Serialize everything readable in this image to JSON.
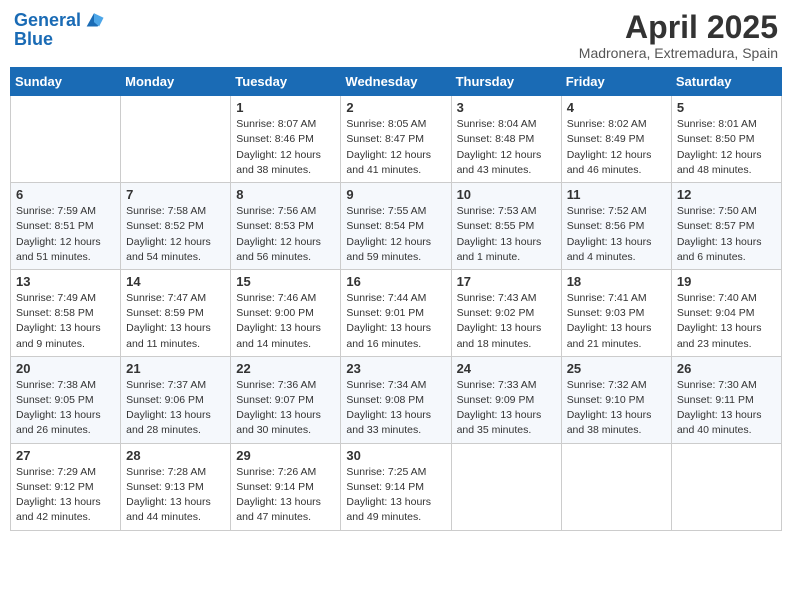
{
  "header": {
    "logo_line1": "General",
    "logo_line2": "Blue",
    "month_title": "April 2025",
    "location": "Madronera, Extremadura, Spain"
  },
  "weekdays": [
    "Sunday",
    "Monday",
    "Tuesday",
    "Wednesday",
    "Thursday",
    "Friday",
    "Saturday"
  ],
  "weeks": [
    [
      {
        "day": "",
        "sunrise": "",
        "sunset": "",
        "daylight": ""
      },
      {
        "day": "",
        "sunrise": "",
        "sunset": "",
        "daylight": ""
      },
      {
        "day": "1",
        "sunrise": "Sunrise: 8:07 AM",
        "sunset": "Sunset: 8:46 PM",
        "daylight": "Daylight: 12 hours and 38 minutes."
      },
      {
        "day": "2",
        "sunrise": "Sunrise: 8:05 AM",
        "sunset": "Sunset: 8:47 PM",
        "daylight": "Daylight: 12 hours and 41 minutes."
      },
      {
        "day": "3",
        "sunrise": "Sunrise: 8:04 AM",
        "sunset": "Sunset: 8:48 PM",
        "daylight": "Daylight: 12 hours and 43 minutes."
      },
      {
        "day": "4",
        "sunrise": "Sunrise: 8:02 AM",
        "sunset": "Sunset: 8:49 PM",
        "daylight": "Daylight: 12 hours and 46 minutes."
      },
      {
        "day": "5",
        "sunrise": "Sunrise: 8:01 AM",
        "sunset": "Sunset: 8:50 PM",
        "daylight": "Daylight: 12 hours and 48 minutes."
      }
    ],
    [
      {
        "day": "6",
        "sunrise": "Sunrise: 7:59 AM",
        "sunset": "Sunset: 8:51 PM",
        "daylight": "Daylight: 12 hours and 51 minutes."
      },
      {
        "day": "7",
        "sunrise": "Sunrise: 7:58 AM",
        "sunset": "Sunset: 8:52 PM",
        "daylight": "Daylight: 12 hours and 54 minutes."
      },
      {
        "day": "8",
        "sunrise": "Sunrise: 7:56 AM",
        "sunset": "Sunset: 8:53 PM",
        "daylight": "Daylight: 12 hours and 56 minutes."
      },
      {
        "day": "9",
        "sunrise": "Sunrise: 7:55 AM",
        "sunset": "Sunset: 8:54 PM",
        "daylight": "Daylight: 12 hours and 59 minutes."
      },
      {
        "day": "10",
        "sunrise": "Sunrise: 7:53 AM",
        "sunset": "Sunset: 8:55 PM",
        "daylight": "Daylight: 13 hours and 1 minute."
      },
      {
        "day": "11",
        "sunrise": "Sunrise: 7:52 AM",
        "sunset": "Sunset: 8:56 PM",
        "daylight": "Daylight: 13 hours and 4 minutes."
      },
      {
        "day": "12",
        "sunrise": "Sunrise: 7:50 AM",
        "sunset": "Sunset: 8:57 PM",
        "daylight": "Daylight: 13 hours and 6 minutes."
      }
    ],
    [
      {
        "day": "13",
        "sunrise": "Sunrise: 7:49 AM",
        "sunset": "Sunset: 8:58 PM",
        "daylight": "Daylight: 13 hours and 9 minutes."
      },
      {
        "day": "14",
        "sunrise": "Sunrise: 7:47 AM",
        "sunset": "Sunset: 8:59 PM",
        "daylight": "Daylight: 13 hours and 11 minutes."
      },
      {
        "day": "15",
        "sunrise": "Sunrise: 7:46 AM",
        "sunset": "Sunset: 9:00 PM",
        "daylight": "Daylight: 13 hours and 14 minutes."
      },
      {
        "day": "16",
        "sunrise": "Sunrise: 7:44 AM",
        "sunset": "Sunset: 9:01 PM",
        "daylight": "Daylight: 13 hours and 16 minutes."
      },
      {
        "day": "17",
        "sunrise": "Sunrise: 7:43 AM",
        "sunset": "Sunset: 9:02 PM",
        "daylight": "Daylight: 13 hours and 18 minutes."
      },
      {
        "day": "18",
        "sunrise": "Sunrise: 7:41 AM",
        "sunset": "Sunset: 9:03 PM",
        "daylight": "Daylight: 13 hours and 21 minutes."
      },
      {
        "day": "19",
        "sunrise": "Sunrise: 7:40 AM",
        "sunset": "Sunset: 9:04 PM",
        "daylight": "Daylight: 13 hours and 23 minutes."
      }
    ],
    [
      {
        "day": "20",
        "sunrise": "Sunrise: 7:38 AM",
        "sunset": "Sunset: 9:05 PM",
        "daylight": "Daylight: 13 hours and 26 minutes."
      },
      {
        "day": "21",
        "sunrise": "Sunrise: 7:37 AM",
        "sunset": "Sunset: 9:06 PM",
        "daylight": "Daylight: 13 hours and 28 minutes."
      },
      {
        "day": "22",
        "sunrise": "Sunrise: 7:36 AM",
        "sunset": "Sunset: 9:07 PM",
        "daylight": "Daylight: 13 hours and 30 minutes."
      },
      {
        "day": "23",
        "sunrise": "Sunrise: 7:34 AM",
        "sunset": "Sunset: 9:08 PM",
        "daylight": "Daylight: 13 hours and 33 minutes."
      },
      {
        "day": "24",
        "sunrise": "Sunrise: 7:33 AM",
        "sunset": "Sunset: 9:09 PM",
        "daylight": "Daylight: 13 hours and 35 minutes."
      },
      {
        "day": "25",
        "sunrise": "Sunrise: 7:32 AM",
        "sunset": "Sunset: 9:10 PM",
        "daylight": "Daylight: 13 hours and 38 minutes."
      },
      {
        "day": "26",
        "sunrise": "Sunrise: 7:30 AM",
        "sunset": "Sunset: 9:11 PM",
        "daylight": "Daylight: 13 hours and 40 minutes."
      }
    ],
    [
      {
        "day": "27",
        "sunrise": "Sunrise: 7:29 AM",
        "sunset": "Sunset: 9:12 PM",
        "daylight": "Daylight: 13 hours and 42 minutes."
      },
      {
        "day": "28",
        "sunrise": "Sunrise: 7:28 AM",
        "sunset": "Sunset: 9:13 PM",
        "daylight": "Daylight: 13 hours and 44 minutes."
      },
      {
        "day": "29",
        "sunrise": "Sunrise: 7:26 AM",
        "sunset": "Sunset: 9:14 PM",
        "daylight": "Daylight: 13 hours and 47 minutes."
      },
      {
        "day": "30",
        "sunrise": "Sunrise: 7:25 AM",
        "sunset": "Sunset: 9:14 PM",
        "daylight": "Daylight: 13 hours and 49 minutes."
      },
      {
        "day": "",
        "sunrise": "",
        "sunset": "",
        "daylight": ""
      },
      {
        "day": "",
        "sunrise": "",
        "sunset": "",
        "daylight": ""
      },
      {
        "day": "",
        "sunrise": "",
        "sunset": "",
        "daylight": ""
      }
    ]
  ]
}
